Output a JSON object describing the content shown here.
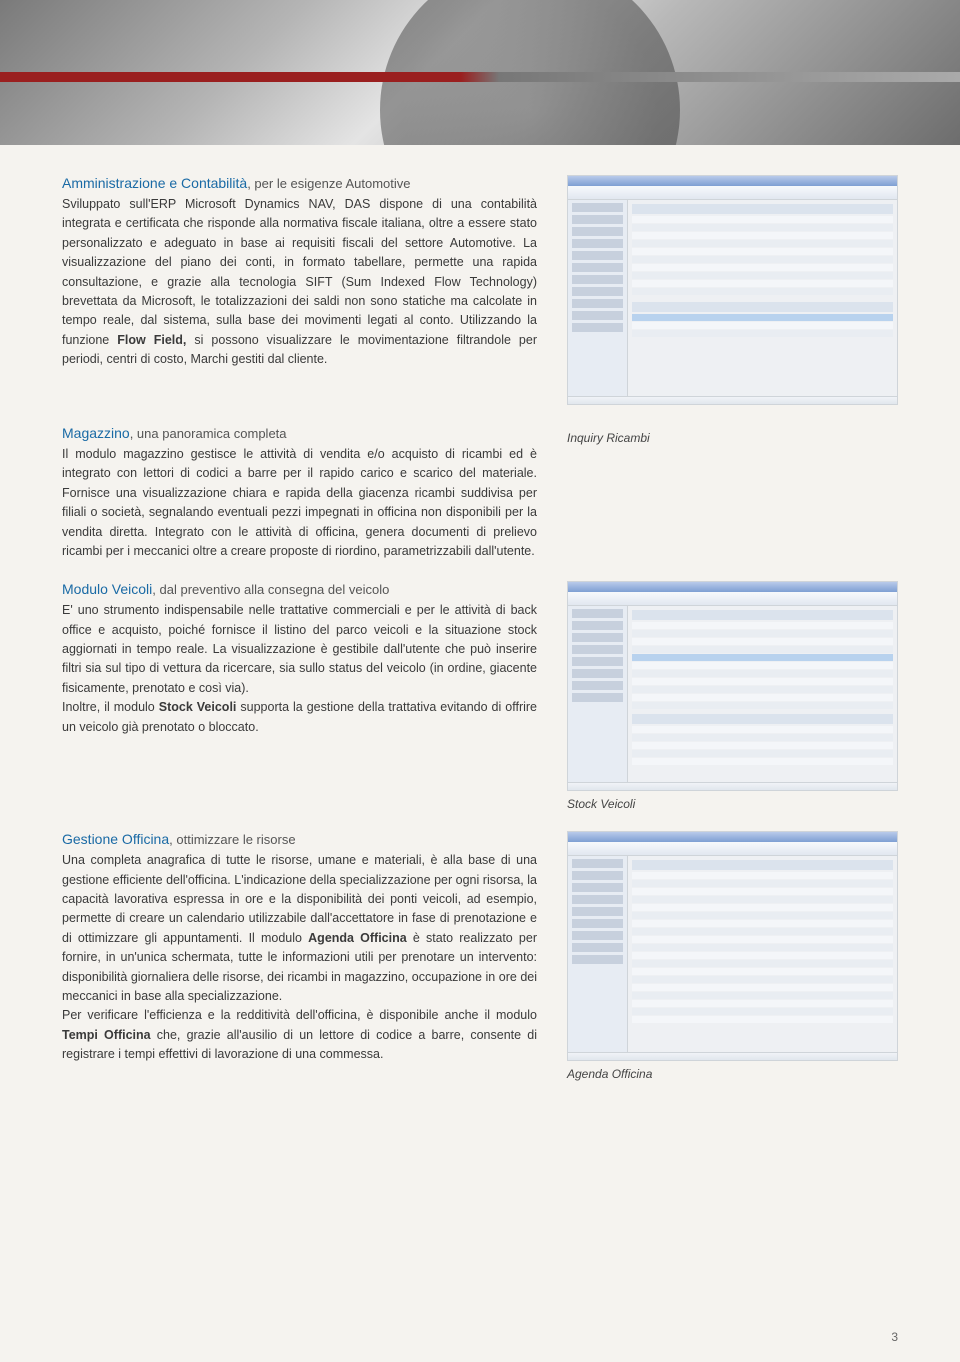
{
  "page_number": "3",
  "sections": {
    "admin": {
      "title": "Amministrazione e Contabilità",
      "subtitle": ", per le esigenze Automotive",
      "body_parts": [
        "Sviluppato sull'ERP Microsoft Dynamics NAV, DAS dispone di una contabilità integrata e certificata che risponde alla normativa fiscale italiana, oltre a essere stato personalizzato e adeguato in base ai requisiti fiscali del settore Automotive.",
        "La visualizzazione del piano dei conti, in formato tabellare, permette una rapida consultazione, e grazie alla tecnologia SIFT (Sum Indexed Flow Technology) brevettata da Microsoft, le totalizzazioni dei saldi non sono statiche ma calcolate in tempo reale, dal sistema, sulla base dei movimenti legati al conto. Utilizzando la funzione ",
        "Flow Field,",
        " si possono visualizzare le movimentazione filtrandole per periodi, centri di costo, Marchi gestiti dal cliente."
      ]
    },
    "magazzino": {
      "title": "Magazzino",
      "subtitle": ", una panoramica completa",
      "body": "Il modulo magazzino gestisce le attività di vendita e/o acquisto di ricambi ed è integrato con lettori di codici a barre per il rapido carico e scarico del materiale. Fornisce una visualizzazione chiara e rapida della giacenza ricambi suddivisa per filiali o società, segnalando eventuali pezzi impegnati in officina non disponibili per la vendita diretta. Integrato con le attività di officina, genera documenti di prelievo ricambi per i meccanici oltre a creare proposte di riordino, parametrizzabili dall'utente.",
      "caption": "Inquiry Ricambi"
    },
    "veicoli": {
      "title": "Modulo Veicoli",
      "subtitle": ", dal preventivo alla consegna del veicolo",
      "body_parts": [
        "E' uno strumento indispensabile nelle trattative commerciali e per le attività di back office e acquisto, poiché fornisce il listino del parco veicoli e la situazione stock aggiornati in tempo reale. La visualizzazione è gestibile dall'utente che può inserire filtri sia sul tipo di vettura da ricercare, sia sullo status del veicolo (in ordine, giacente fisicamente, prenotato e così via).",
        "Inoltre, il modulo ",
        "Stock Veicoli",
        " supporta la gestione della trattativa evitando di offrire un veicolo già prenotato o bloccato."
      ],
      "caption": "Stock Veicoli"
    },
    "officina": {
      "title": "Gestione Officina",
      "subtitle": ", ottimizzare le risorse",
      "body_parts": [
        "Una completa anagrafica di tutte le risorse, umane e materiali, è alla base di una gestione efficiente dell'officina. L'indicazione della specializzazione per ogni risorsa, la capacità lavorativa espressa in ore e la disponibilità dei ponti veicoli, ad esempio, permette di creare un calendario utilizzabile dall'accettatore in fase di prenotazione e di ottimizzare gli appuntamenti. Il modulo ",
        "Agenda Officina",
        " è stato realizzato per fornire, in un'unica schermata, tutte le informazioni utili per prenotare un intervento: disponibilità giornaliera delle risorse, dei ricambi in magazzino, occupazione in ore dei meccanici in base alla specializzazione.",
        "Per verificare l'efficienza e la redditività dell'officina, è disponibile anche il modulo ",
        "Tempi Officina",
        " che, grazie all'ausilio di un lettore di codice a barre, consente di registrare i tempi effettivi di lavorazione di una commessa."
      ],
      "caption": "Agenda Officina"
    }
  }
}
